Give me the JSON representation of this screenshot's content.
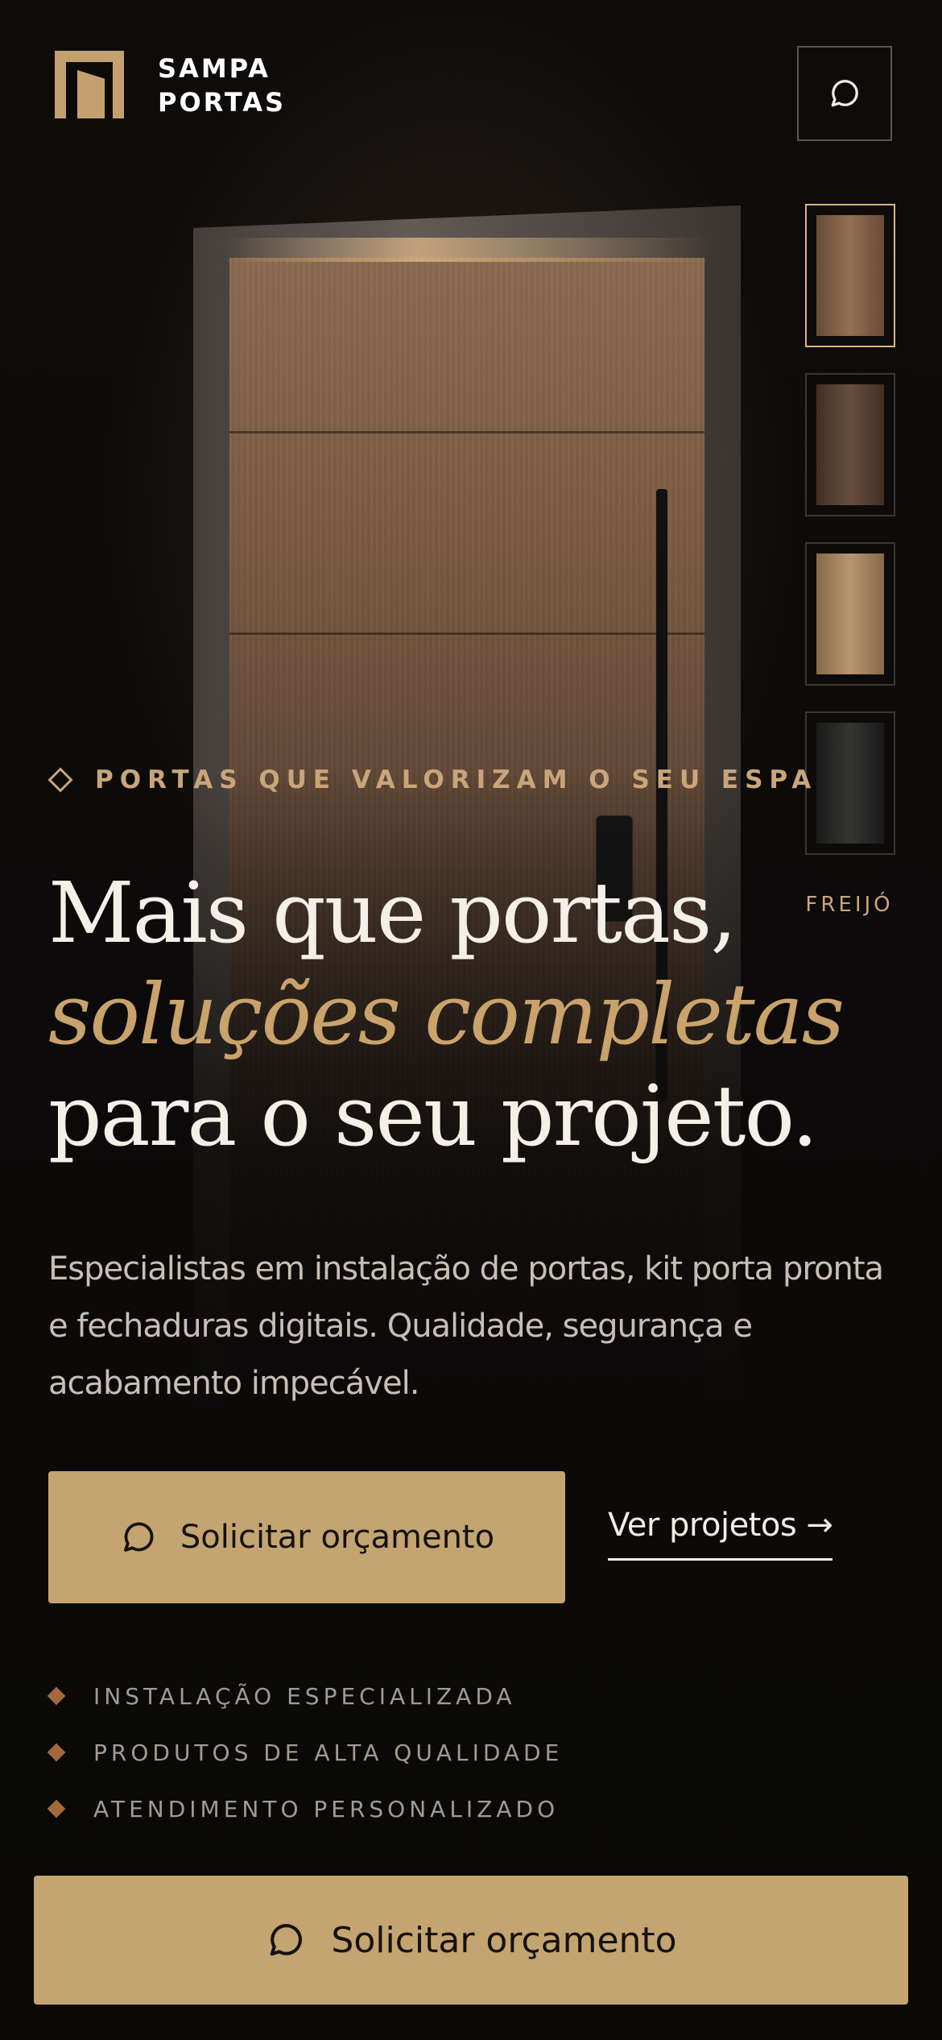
{
  "header": {
    "brand_line1": "SAMPA",
    "brand_line2": "PORTAS",
    "chat_icon": "chat-bubble-icon"
  },
  "finishes": {
    "items": [
      {
        "name": "wood-medium",
        "color": "#8a6446",
        "selected": true
      },
      {
        "name": "wood-dark",
        "color": "#5a3f2d",
        "selected": false
      },
      {
        "name": "wood-light",
        "color": "#b18d62",
        "selected": false
      },
      {
        "name": "black",
        "color": "#242322",
        "selected": false
      }
    ],
    "selected_label": "FREIJÓ"
  },
  "hero": {
    "eyebrow": "PORTAS QUE VALORIZAM O SEU ESPAÇO",
    "title_line1": "Mais que portas,",
    "title_line2": "soluções completas",
    "title_line3": "para o seu projeto.",
    "description": "Especialistas em instalação de portas, kit porta pronta e fechaduras digitais. Qualidade, segurança e acabamento impecável."
  },
  "cta": {
    "primary_label": "Solicitar orçamento",
    "secondary_label": "Ver projetos →"
  },
  "features": [
    "INSTALAÇÃO ESPECIALIZADA",
    "PRODUTOS DE ALTA QUALIDADE",
    "ATENDIMENTO PERSONALIZADO"
  ],
  "sticky_cta": {
    "label": "Solicitar orçamento"
  },
  "colors": {
    "accent": "#c4a470",
    "background": "#0b0a09",
    "gold_text": "#c9a57a"
  }
}
